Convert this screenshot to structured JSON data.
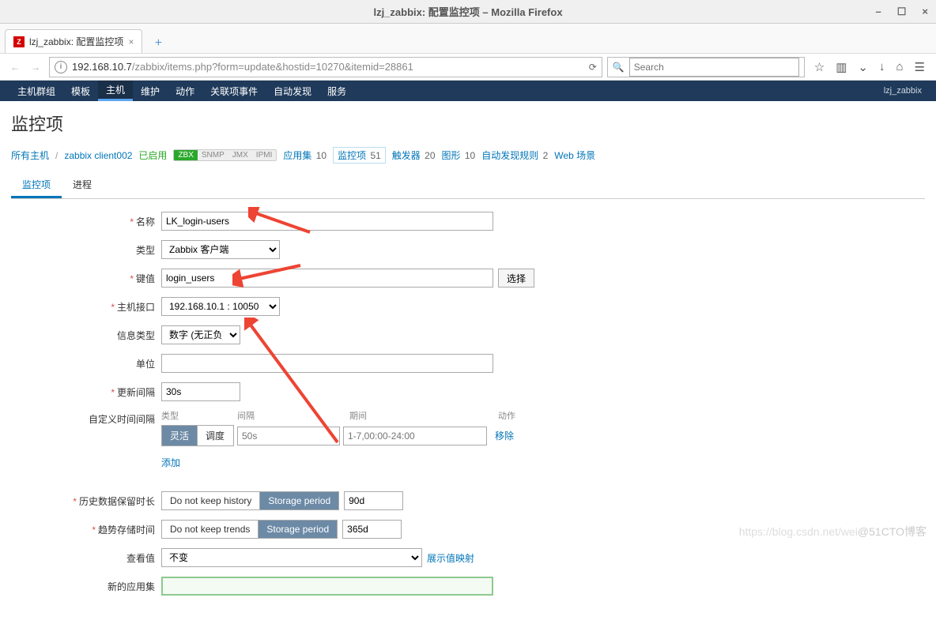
{
  "window": {
    "title": "lzj_zabbix: 配置监控项 – Mozilla Firefox"
  },
  "browser": {
    "tab_title": "lzj_zabbix: 配置监控项",
    "url_prefix": "192.168.10.7",
    "url_path": "/zabbix/items.php?form=update&hostid=10270&itemid=28861",
    "search_placeholder": "Search"
  },
  "nav": {
    "items": [
      "主机群组",
      "模板",
      "主机",
      "维护",
      "动作",
      "关联项事件",
      "自动发现",
      "服务"
    ],
    "active_index": 2,
    "user": "lzj_zabbix"
  },
  "page": {
    "title": "监控项"
  },
  "breadcrumb": {
    "all_hosts": "所有主机",
    "host": "zabbix client002",
    "enabled": "已启用",
    "badges": {
      "zbx": "ZBX",
      "snmp": "SNMP",
      "jmx": "JMX",
      "ipmi": "IPMI"
    },
    "links": [
      {
        "label": "应用集",
        "count": "10"
      },
      {
        "label": "监控项",
        "count": "51",
        "boxed": true
      },
      {
        "label": "触发器",
        "count": "20"
      },
      {
        "label": "图形",
        "count": "10"
      },
      {
        "label": "自动发现规则",
        "count": "2"
      },
      {
        "label": "Web 场景",
        "count": ""
      }
    ]
  },
  "tabs": {
    "items": [
      "监控项",
      "进程"
    ],
    "active": 0
  },
  "form": {
    "name_label": "名称",
    "name_value": "LK_login-users",
    "type_label": "类型",
    "type_value": "Zabbix 客户端",
    "key_label": "键值",
    "key_value": "login_users",
    "select_btn": "选择",
    "iface_label": "主机接口",
    "iface_value": "192.168.10.1 : 10050",
    "info_label": "信息类型",
    "info_value": "数字 (无正负)",
    "unit_label": "单位",
    "unit_value": "",
    "interval_label": "更新间隔",
    "interval_value": "30s",
    "custom_label": "自定义时间间隔",
    "custom_cols": {
      "type": "类型",
      "interval": "间隔",
      "period": "期间",
      "action": "动作"
    },
    "custom_row": {
      "flex": "灵活",
      "sched": "调度",
      "interval_ph": "50s",
      "period_ph": "1-7,00:00-24:00",
      "remove": "移除"
    },
    "add_link": "添加",
    "history_label": "历史数据保留时长",
    "history_opts": {
      "no_keep": "Do not keep history",
      "storage": "Storage period"
    },
    "history_value": "90d",
    "trend_label": "趋势存储时间",
    "trend_opts": {
      "no_keep": "Do not keep trends",
      "storage": "Storage period"
    },
    "trend_value": "365d",
    "display_label": "查看值",
    "display_value": "不变",
    "display_mapping": "展示值映射",
    "newapp_label": "新的应用集",
    "newapp_value": ""
  },
  "watermark": {
    "left": "https://blog.csdn.net/wei",
    "right": "@51CTO博客"
  }
}
